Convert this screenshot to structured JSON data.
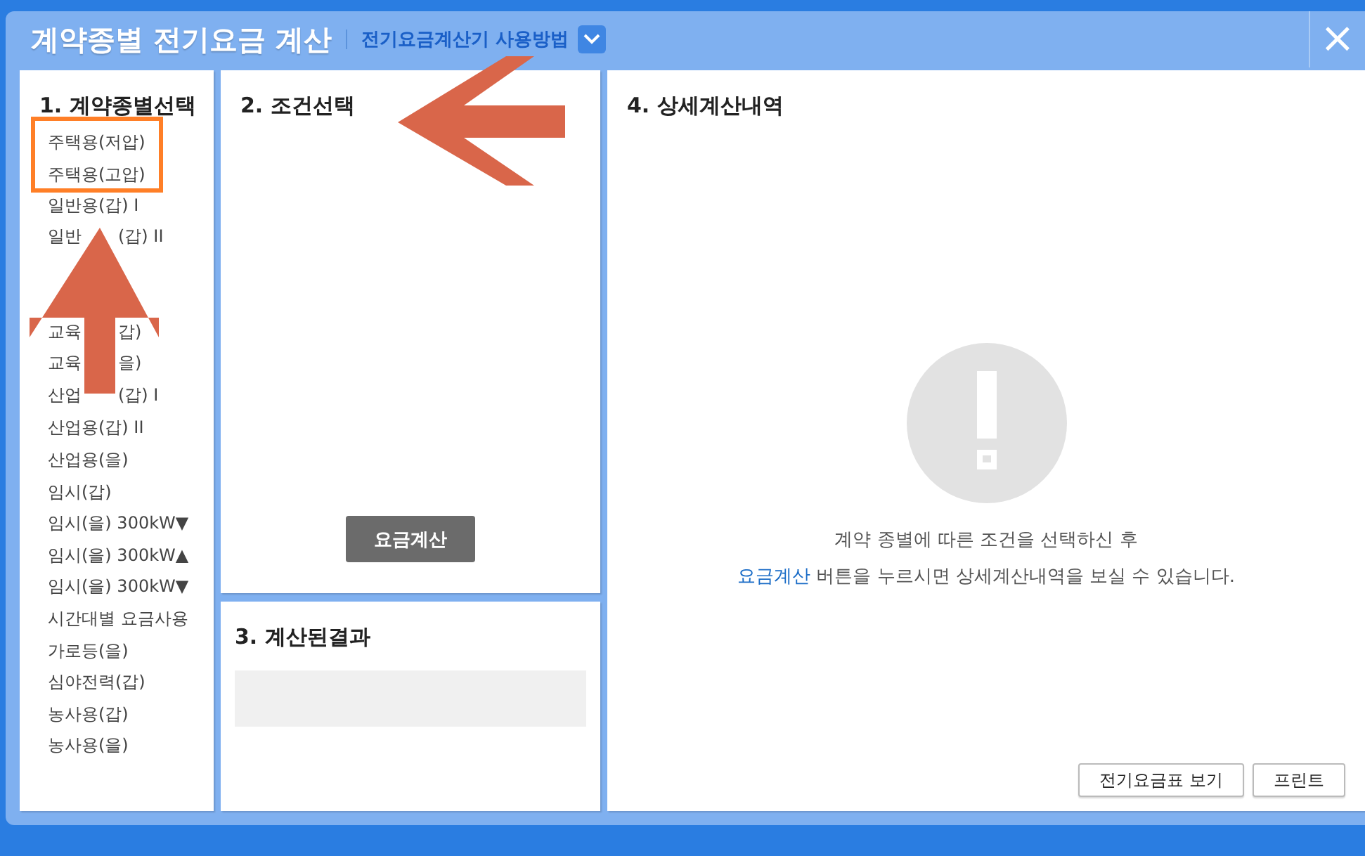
{
  "window": {
    "title": "계약종별 전기요금 계산",
    "help_link": "전기요금계산기 사용방법",
    "close": "×"
  },
  "contract_panel": {
    "heading": "1. 계약종별선택",
    "items": [
      {
        "label": "주택용(저압)",
        "selected": false
      },
      {
        "label": "주택용(고압)",
        "selected": false
      },
      {
        "label": "일반용(갑) I",
        "selected": false
      },
      {
        "kind": "covered",
        "parts": [
          "일반",
          "(갑) II"
        ]
      },
      {
        "kind": "hidden"
      },
      {
        "kind": "hidden"
      },
      {
        "kind": "covered",
        "parts": [
          "교육",
          "갑)"
        ]
      },
      {
        "kind": "covered",
        "parts": [
          "교육",
          "을)"
        ]
      },
      {
        "kind": "covered",
        "parts": [
          "산업",
          "(갑) I"
        ]
      },
      {
        "label": "산업용(갑) II",
        "selected": false
      },
      {
        "label": "산업용(을)",
        "selected": false
      },
      {
        "label": "임시(갑)",
        "selected": false
      },
      {
        "label": "임시(을) 300kW▼",
        "selected": false
      },
      {
        "label": "임시(을) 300kW▲",
        "selected": false
      },
      {
        "label": "임시(을) 300kW▼",
        "selected": false
      },
      {
        "label": "시간대별 요금사용",
        "selected": false
      },
      {
        "label": "가로등(을)",
        "selected": false
      },
      {
        "label": "심야전력(갑)",
        "selected": false
      },
      {
        "label": "농사용(갑)",
        "selected": false
      },
      {
        "label": "농사용(을)",
        "selected": false
      }
    ]
  },
  "condition_panel": {
    "heading": "2. 조건선택",
    "calculate_button": "요금계산"
  },
  "result_panel": {
    "heading": "3. 계산된결과"
  },
  "detail_panel": {
    "heading": "4. 상세계산내역",
    "message_line1": "계약 종별에 따른 조건을 선택하신 후",
    "message_link": "요금계산",
    "message_line2": "버튼을 누르시면 상세계산내역을 보실 수 있습니다.",
    "buttons": [
      "전기요금표 보기",
      "프린트"
    ]
  }
}
